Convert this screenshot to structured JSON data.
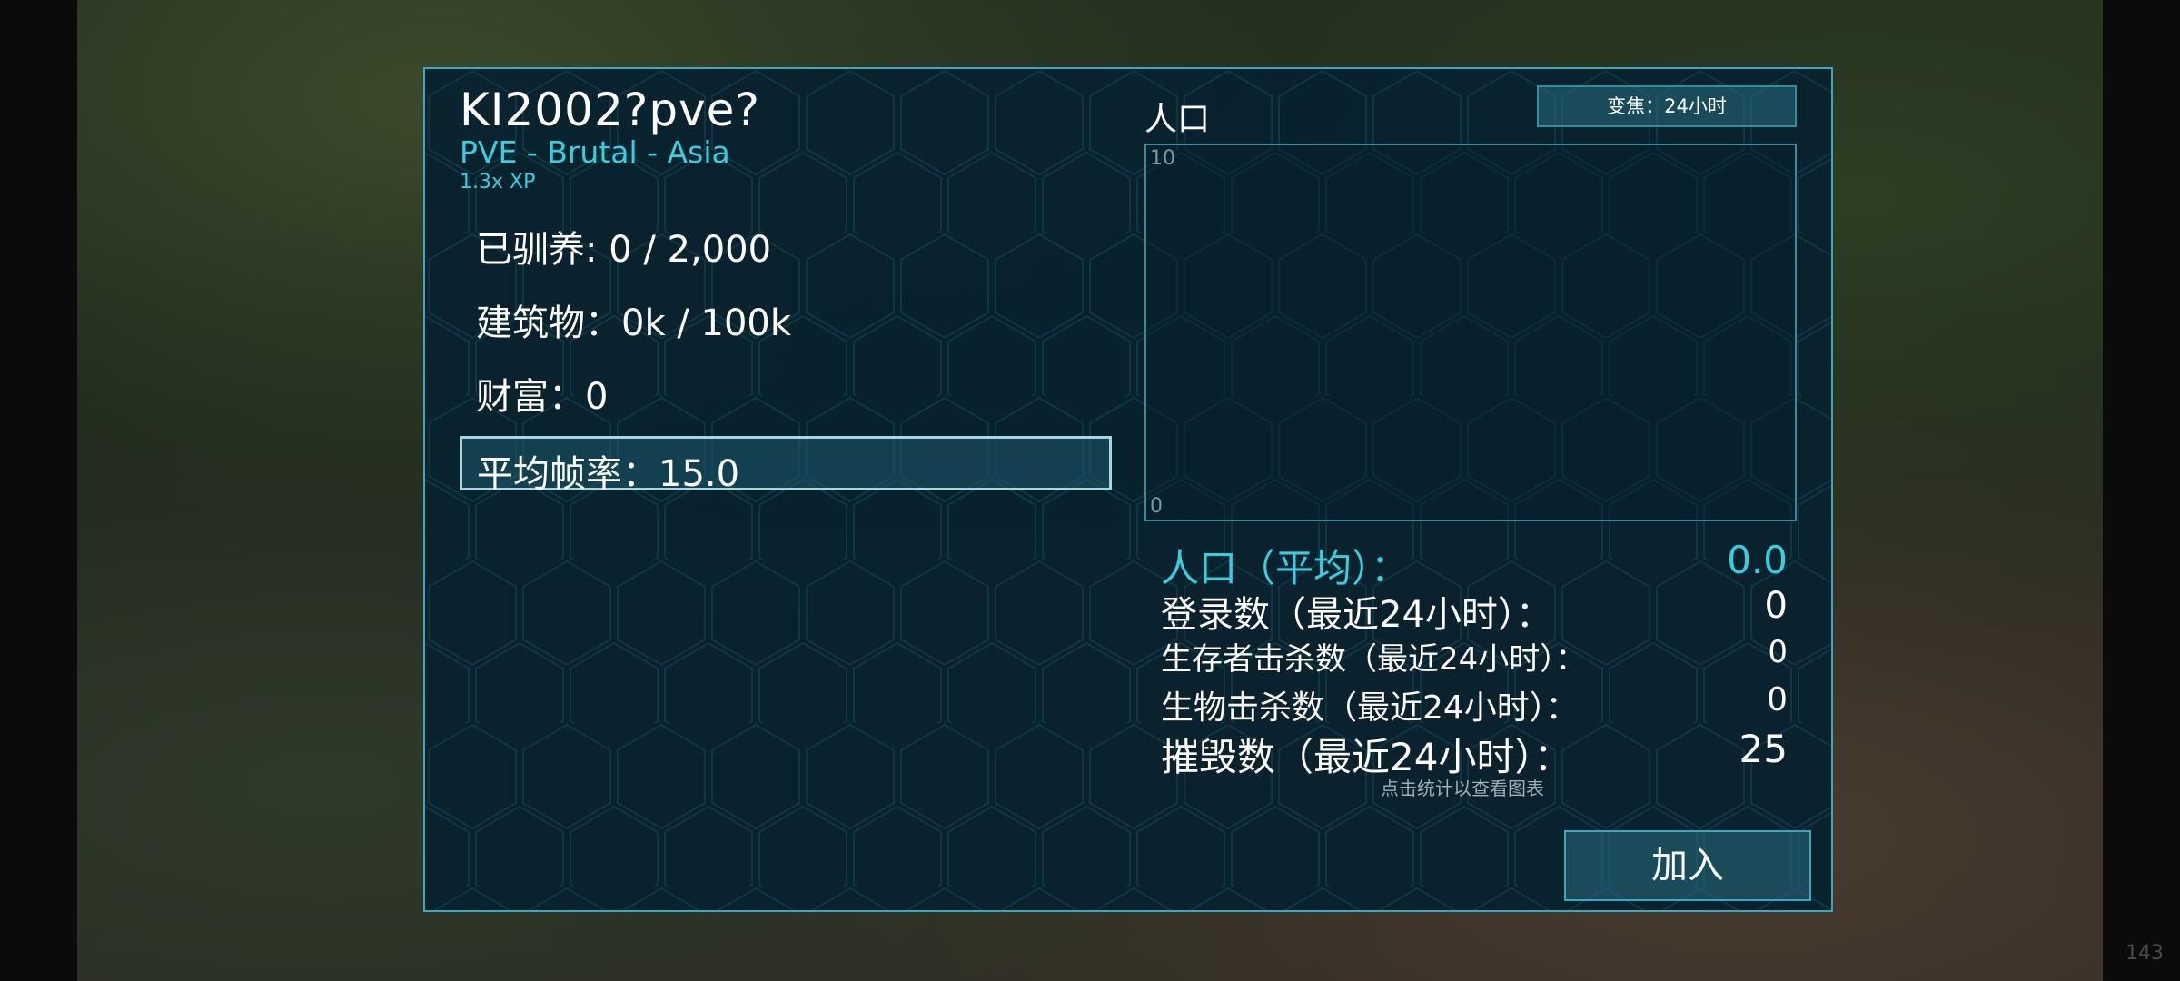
{
  "server": {
    "name": "KI2002?pve?",
    "mode": "PVE - Brutal - Asia",
    "rate": "1.3x XP"
  },
  "stats": {
    "tamed": "已驯养: 0 / 2,000",
    "structures": "建筑物：0k / 100k",
    "wealth": "财富：0",
    "avg_fps": "平均帧率：15.0"
  },
  "population_chart": {
    "label": "人口",
    "zoom_button": "变焦：24小时",
    "y_max": "10",
    "y_min": "0"
  },
  "chart_data": {
    "type": "line",
    "title": "人口",
    "ylim": [
      0,
      10
    ],
    "series": []
  },
  "summary": [
    {
      "label": "人口（平均）：",
      "value": "0.0"
    },
    {
      "label": "登录数（最近24小时）：",
      "value": "0"
    },
    {
      "label": "生存者击杀数（最近24小时）：",
      "value": "0"
    },
    {
      "label": "生物击杀数（最近24小时）：",
      "value": "0"
    },
    {
      "label": "摧毁数（最近24小时）：",
      "value": "25"
    }
  ],
  "hint": "点击统计以查看图表",
  "join_button": "加入",
  "fps_counter": "143",
  "colors": {
    "accent": "#35d0e0",
    "border": "#3fa7b8",
    "panel_bg": "#08263a"
  }
}
